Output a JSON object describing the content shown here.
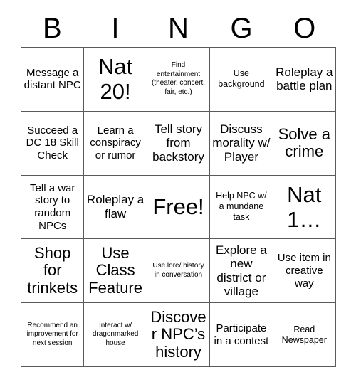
{
  "header": {
    "letters": [
      "B",
      "I",
      "N",
      "G",
      "O"
    ]
  },
  "grid": {
    "rows": 5,
    "columns": 5,
    "border_color": "#5a5a5a",
    "background": "#ffffff",
    "text_color": "#000000"
  },
  "cells": [
    {
      "text": "Message a distant NPC",
      "size": "md"
    },
    {
      "text": "Nat 20!",
      "size": "xxl"
    },
    {
      "text": "Find entertainment (theater, concert, fair, etc.)",
      "size": "xs"
    },
    {
      "text": "Use background",
      "size": "sm"
    },
    {
      "text": "Roleplay a battle plan",
      "size": "lg"
    },
    {
      "text": "Succeed a DC 18 Skill Check",
      "size": "md"
    },
    {
      "text": "Learn a conspiracy or rumor",
      "size": "md"
    },
    {
      "text": "Tell story from backstory",
      "size": "lg"
    },
    {
      "text": "Discuss morality w/ Player",
      "size": "lg"
    },
    {
      "text": "Solve a crime",
      "size": "xl"
    },
    {
      "text": "Tell a war story to random NPCs",
      "size": "md"
    },
    {
      "text": "Roleplay a flaw",
      "size": "lg"
    },
    {
      "text": "Free!",
      "size": "xxl"
    },
    {
      "text": "Help NPC w/ a mundane task",
      "size": "sm"
    },
    {
      "text": "Nat 1…",
      "size": "xxl"
    },
    {
      "text": "Shop for trinkets",
      "size": "xl"
    },
    {
      "text": "Use Class Feature",
      "size": "xl"
    },
    {
      "text": "Use lore/ history in conversation",
      "size": "xs"
    },
    {
      "text": "Explore a new district or village",
      "size": "lg"
    },
    {
      "text": "Use item in creative way",
      "size": "md"
    },
    {
      "text": "Recommend an improvement for next session",
      "size": "xs"
    },
    {
      "text": "Interact w/ dragonmarked house",
      "size": "xs"
    },
    {
      "text": "Discover NPC’s history",
      "size": "xl"
    },
    {
      "text": "Participate in a contest",
      "size": "md"
    },
    {
      "text": "Read Newspaper",
      "size": "sm"
    }
  ]
}
